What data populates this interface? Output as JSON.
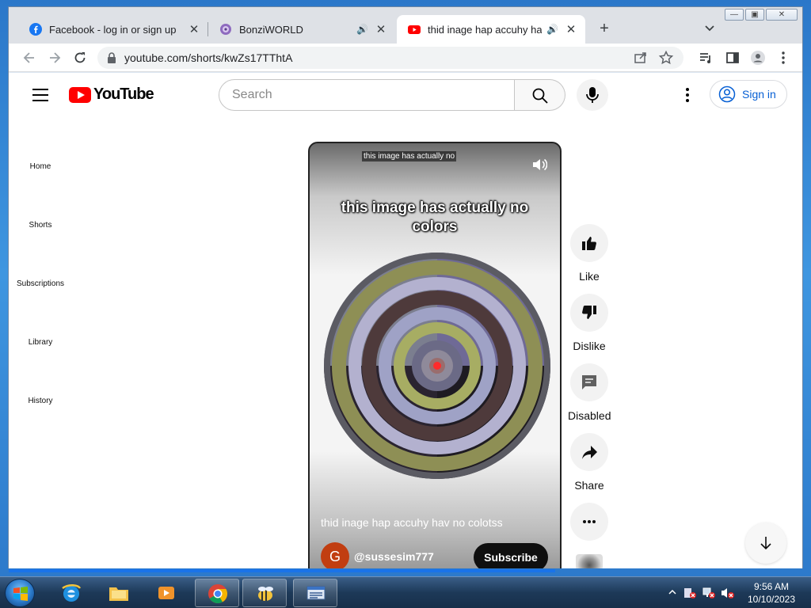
{
  "browser": {
    "tabs": [
      {
        "title": "Facebook - log in or sign up",
        "favicon": "facebook-icon"
      },
      {
        "title": "BonziWORLD",
        "favicon": "bonzi-icon"
      },
      {
        "title": "thid inage hap accuhy hav no colotss",
        "favicon": "youtube-icon"
      }
    ],
    "url": "youtube.com/shorts/kwZs17TThtA"
  },
  "youtube": {
    "logo_text": "YouTube",
    "search_placeholder": "Search",
    "sign_in": "Sign in",
    "nav": [
      "Home",
      "Shorts",
      "Subscriptions",
      "Library",
      "History"
    ]
  },
  "short": {
    "caption_top": "this image has actually no",
    "overlay_text": "this image has actually no colors",
    "title": "thid inage hap accuhy hav no colotss",
    "channel_initial": "G",
    "channel_handle": "@sussesim777",
    "subscribe": "Subscribe"
  },
  "actions": {
    "like": "Like",
    "dislike": "Dislike",
    "comments": "Disabled",
    "share": "Share"
  },
  "taskbar": {
    "time": "9:56 AM",
    "date": "10/10/2023"
  },
  "colors": {
    "youtube_red": "#ff0000",
    "link_blue": "#065fd4",
    "avatar": "#c13e11"
  }
}
